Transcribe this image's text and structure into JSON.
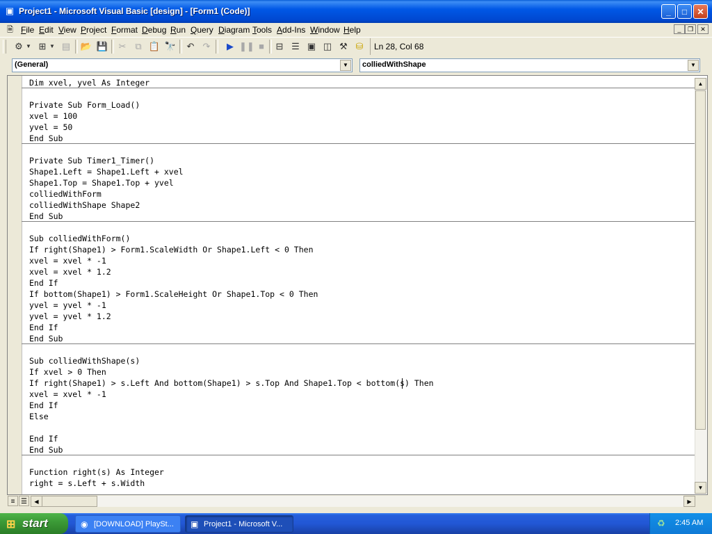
{
  "window": {
    "title": "Project1 - Microsoft Visual Basic [design] - [Form1 (Code)]",
    "controls": {
      "minimize": "_",
      "maximize": "□",
      "close": "✕"
    }
  },
  "menu": [
    "File",
    "Edit",
    "View",
    "Project",
    "Format",
    "Debug",
    "Run",
    "Query",
    "Diagram",
    "Tools",
    "Add-Ins",
    "Window",
    "Help"
  ],
  "toolbar": {
    "position": "Ln 28, Col 68",
    "icons": [
      "add-project-icon",
      "add-form-icon",
      "menu-editor-icon",
      "open-icon",
      "save-icon",
      "cut-icon",
      "copy-icon",
      "paste-icon",
      "find-icon",
      "undo-icon",
      "redo-icon",
      "run-icon",
      "break-icon",
      "stop-icon",
      "project-explorer-icon",
      "properties-icon",
      "form-layout-icon",
      "toolbox-icon",
      "data-view-icon"
    ]
  },
  "combos": {
    "object": "(General)",
    "procedure": "colliedWithShape"
  },
  "code": [
    "Dim xvel, yvel As Integer",
    "",
    "Private Sub Form_Load()",
    "xvel = 100",
    "yvel = 50",
    "End Sub",
    "",
    "Private Sub Timer1_Timer()",
    "Shape1.Left = Shape1.Left + xvel",
    "Shape1.Top = Shape1.Top + yvel",
    "colliedWithForm",
    "colliedWithShape Shape2",
    "End Sub",
    "",
    "Sub colliedWithForm()",
    "If right(Shape1) > Form1.ScaleWidth Or Shape1.Left < 0 Then",
    "xvel = xvel * -1",
    "xvel = xvel * 1.2",
    "End If",
    "If bottom(Shape1) > Form1.ScaleHeight Or Shape1.Top < 0 Then",
    "yvel = yvel * -1",
    "yvel = yvel * 1.2",
    "End If",
    "End Sub",
    "",
    "Sub colliedWithShape(s)",
    "If xvel > 0 Then",
    "If right(Shape1) > s.Left And bottom(Shape1) > s.Top And Shape1.Top < bottom(s) Then",
    "xvel = xvel * -1",
    "End If",
    "Else",
    "",
    "End If",
    "End Sub",
    "",
    "Function right(s) As Integer",
    "right = s.Left + s.Width"
  ],
  "taskbar": {
    "start": "start",
    "tasks": [
      {
        "label": "[DOWNLOAD] PlaySt...",
        "active": false
      },
      {
        "label": "Project1 - Microsoft V...",
        "active": true
      }
    ],
    "clock": "2:45 AM"
  }
}
